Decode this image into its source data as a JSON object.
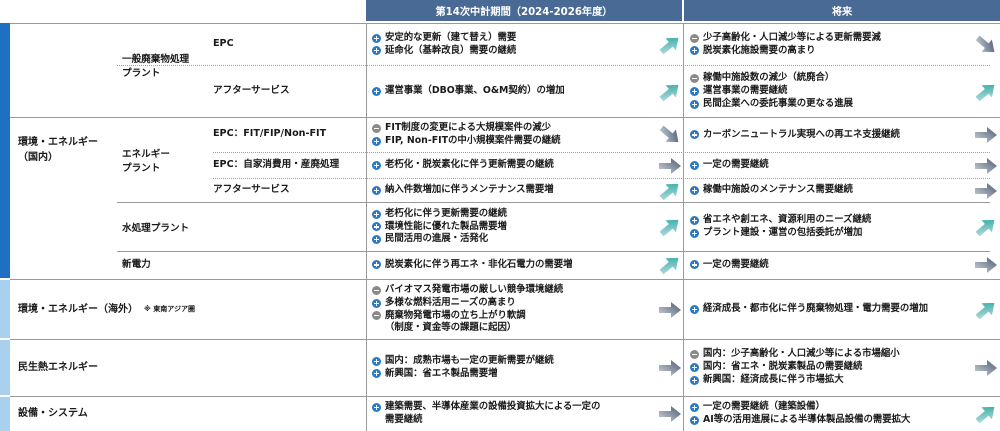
{
  "headers": {
    "current_period": "第14次中計期間（2024-2026年度）",
    "future": "将来"
  },
  "colors": {
    "header_bg": "#4a6a96",
    "plus_icon": "#2b78c6",
    "minus_icon": "#8a8a8a",
    "arrow_up": "#1aa39a",
    "arrow_flat": "#4a5a70",
    "arrow_down": "#3d4f68",
    "section_stripe_dark": "#1f6fc2",
    "section_stripe_light": "#a8d0ef"
  },
  "sections": {
    "domestic": "環境・エネルギー\n（国内）",
    "overseas": "環境・エネルギー（海外）",
    "overseas_note": "※ 東南アジア圏",
    "heat": "民生熱エネルギー",
    "equipment": "設備・システム"
  },
  "groups": {
    "waste_plant": "一般廃棄物処理\nプラント",
    "energy_plant": "エネルギー\nプラント",
    "water_plant": "水処理プラント",
    "new_power": "新電力"
  },
  "subs": {
    "epc": "EPC",
    "after1": "アフターサービス",
    "epc_fit": "EPC：FIT/FIP/Non-FIT",
    "epc_self": "EPC：自家消費用・産廃処理",
    "after2": "アフターサービス"
  },
  "rows": [
    {
      "current": [
        {
          "sign": "plus",
          "text": "安定的な更新（建て替え）需要"
        },
        {
          "sign": "plus",
          "text": "延命化（基幹改良）需要の継続"
        }
      ],
      "current_trend": "up",
      "future": [
        {
          "sign": "minus",
          "text": "少子高齢化・人口減少等による更新需要減"
        },
        {
          "sign": "plus",
          "text": "脱炭素化施設需要の高まり"
        }
      ],
      "future_trend": "down"
    },
    {
      "current": [
        {
          "sign": "plus",
          "text": "運営事業（DBO事業、O&M契約）の増加"
        }
      ],
      "current_trend": "up",
      "future": [
        {
          "sign": "minus",
          "text": "稼働中施設数の減少（統廃合）"
        },
        {
          "sign": "plus",
          "text": "運営事業の需要継続"
        },
        {
          "sign": "plus",
          "text": "民間企業への委託事業の更なる進展"
        }
      ],
      "future_trend": "up"
    },
    {
      "current": [
        {
          "sign": "minus",
          "text": "FIT制度の変更による大規模案件の減少"
        },
        {
          "sign": "plus",
          "text": "FIP, Non-FITの中小規模案件需要の継続"
        }
      ],
      "current_trend": "down",
      "future": [
        {
          "sign": "plus",
          "text": "カーボンニュートラル実現への再エネ支援継続"
        }
      ],
      "future_trend": "flat"
    },
    {
      "current": [
        {
          "sign": "plus",
          "text": "老朽化・脱炭素化に伴う更新需要の継続"
        }
      ],
      "current_trend": "flat",
      "future": [
        {
          "sign": "plus",
          "text": "一定の需要継続"
        }
      ],
      "future_trend": "flat"
    },
    {
      "current": [
        {
          "sign": "plus",
          "text": "納入件数増加に伴うメンテナンス需要増"
        }
      ],
      "current_trend": "up",
      "future": [
        {
          "sign": "plus",
          "text": "稼働中施設のメンテナンス需要継続"
        }
      ],
      "future_trend": "flat"
    },
    {
      "current": [
        {
          "sign": "plus",
          "text": "老朽化に伴う更新需要の継続"
        },
        {
          "sign": "plus",
          "text": "環境性能に優れた製品需要増"
        },
        {
          "sign": "plus",
          "text": "民間活用の進展・活発化"
        }
      ],
      "current_trend": "up",
      "future": [
        {
          "sign": "plus",
          "text": "省エネや創エネ、資源利用のニーズ継続"
        },
        {
          "sign": "plus",
          "text": "プラント建設・運営の包括委託が増加"
        }
      ],
      "future_trend": "up"
    },
    {
      "current": [
        {
          "sign": "plus",
          "text": "脱炭素化に伴う再エネ・非化石電力の需要増"
        }
      ],
      "current_trend": "up",
      "future": [
        {
          "sign": "plus",
          "text": "一定の需要継続"
        }
      ],
      "future_trend": "flat"
    },
    {
      "current": [
        {
          "sign": "minus",
          "text": "バイオマス発電市場の厳しい競争環境継続"
        },
        {
          "sign": "plus",
          "text": "多様な燃料活用ニーズの高まり"
        },
        {
          "sign": "minus",
          "text": "廃棄物発電市場の立ち上がり軟調"
        },
        {
          "sign": "none",
          "text": "（制度・資金等の課題に起因）"
        }
      ],
      "current_trend": "flat",
      "future": [
        {
          "sign": "plus",
          "text": "経済成長・都市化に伴う廃棄物処理・電力需要の増加"
        }
      ],
      "future_trend": "up"
    },
    {
      "current": [
        {
          "sign": "plus",
          "text": "国内：成熟市場も一定の更新需要が継続"
        },
        {
          "sign": "plus",
          "text": "新興国：省エネ製品需要増"
        }
      ],
      "current_trend": "flat",
      "future": [
        {
          "sign": "minus",
          "text": "国内：少子高齢化・人口減少等による市場縮小"
        },
        {
          "sign": "plus",
          "text": "国内：省エネ・脱炭素製品の需要継続"
        },
        {
          "sign": "plus",
          "text": "新興国：経済成長に伴う市場拡大"
        }
      ],
      "future_trend": "flat"
    },
    {
      "current": [
        {
          "sign": "plus",
          "text": "建築需要、半導体産業の設備投資拡大による一定の"
        },
        {
          "sign": "none",
          "text": "需要継続"
        }
      ],
      "current_trend": "flat",
      "future": [
        {
          "sign": "plus",
          "text": "一定の需要継続（建築設備）"
        },
        {
          "sign": "plus",
          "text": "AI等の活用進展による半導体製品設備の需要拡大"
        }
      ],
      "future_trend": "up"
    }
  ]
}
